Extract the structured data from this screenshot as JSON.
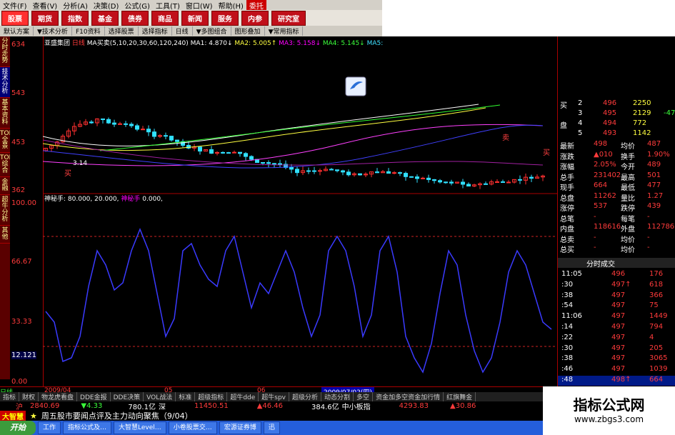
{
  "menu": [
    "文件(F)",
    "查看(V)",
    "分析(A)",
    "决策(D)",
    "公式(G)",
    "工具(T)",
    "窗口(W)",
    "帮助(H)",
    "委托"
  ],
  "tabs": [
    "股票",
    "期货",
    "指数",
    "基金",
    "债券",
    "商品",
    "新闻",
    "服务",
    "内参",
    "研究室"
  ],
  "toolbar": [
    "默认方案",
    "▼技术分析",
    "F10资料",
    "选择股票",
    "选择指标",
    "日线",
    "▼多图组合",
    "图形叠加",
    "▼常用指标"
  ],
  "left_tabs": [
    "分时走势",
    "技术分析",
    "基本资料",
    "TOP全景",
    "TOP综合",
    "金融",
    "超牛分析",
    "其他"
  ],
  "price_axis": [
    "634",
    "543",
    "453",
    "362"
  ],
  "ind_axis": [
    "100.00",
    "66.67",
    "33.33",
    "12.121",
    "0.00"
  ],
  "price_info": {
    "name": "亚盛集团",
    "period": "日线",
    "ma_label": "MA买卖(5,10,20,30,60,120,240)",
    "ma1": "MA1: 4.870↓",
    "ma2": "MA2: 5.005↑",
    "ma3": "MA3: 5.158↓",
    "ma4": "MA4: 5.145↓",
    "ma5": "MA5:"
  },
  "ind_info": {
    "name": "神秘手:",
    "v1": "80.000,",
    "v2": "20.000,",
    "name2": "神秘手",
    "v3": "0.000,"
  },
  "chart_labels": {
    "low": "3.14",
    "buy1": "买",
    "buy2": "买",
    "sell": "卖"
  },
  "bidask": [
    {
      "label": "买",
      "n": "2",
      "price": "496",
      "vol": "2250"
    },
    {
      "label": "",
      "n": "3",
      "price": "495",
      "vol": "2129",
      "extra": "-47"
    },
    {
      "label": "盘",
      "n": "4",
      "price": "494",
      "vol": "772"
    },
    {
      "label": "",
      "n": "5",
      "price": "493",
      "vol": "1142"
    }
  ],
  "quote": [
    {
      "k1": "最新",
      "v1": "498",
      "k2": "均价",
      "v2": "487"
    },
    {
      "k1": "涨跌",
      "v1": "▲010",
      "k2": "换手",
      "v2": "1.90%"
    },
    {
      "k1": "涨幅",
      "v1": "2.05%",
      "k2": "今开",
      "v2": "489"
    },
    {
      "k1": "总手",
      "v1": "231402",
      "k2": "最高",
      "v2": "501"
    },
    {
      "k1": "现手",
      "v1": "664",
      "k2": "最低",
      "v2": "477"
    },
    {
      "k1": "总盘",
      "v1": "11262",
      "k2": "量比",
      "v2": "1.27"
    },
    {
      "k1": "涨停",
      "v1": "537",
      "k2": "跌停",
      "v2": "439"
    },
    {
      "k1": "总笔",
      "v1": "-",
      "k2": "每笔",
      "v2": "-"
    },
    {
      "k1": "内盘",
      "v1": "118616",
      "k2": "外盘",
      "v2": "112786"
    },
    {
      "k1": "总卖",
      "v1": "-",
      "k2": "均价",
      "v2": "-"
    },
    {
      "k1": "总买",
      "v1": "-",
      "k2": "均价",
      "v2": "-"
    }
  ],
  "ticks_title": "分时成交",
  "ticks": [
    {
      "t": "11:05",
      "p": "496",
      "v": "176"
    },
    {
      "t": ":30",
      "p": "497↑",
      "v": "618"
    },
    {
      "t": ":38",
      "p": "497",
      "v": "366"
    },
    {
      "t": ":54",
      "p": "497",
      "v": "75"
    },
    {
      "t": "11:06",
      "p": "497",
      "v": "1449"
    },
    {
      "t": ":14",
      "p": "497",
      "v": "794"
    },
    {
      "t": ":22",
      "p": "497",
      "v": "4"
    },
    {
      "t": ":30",
      "p": "497",
      "v": "205"
    },
    {
      "t": ":38",
      "p": "497",
      "v": "3065"
    },
    {
      "t": ":46",
      "p": "497",
      "v": "1039"
    },
    {
      "t": ":48",
      "p": "498↑",
      "v": "664"
    }
  ],
  "date_bar": {
    "left": "2009/04",
    "mid1": "05",
    "mid2": "06",
    "date": "2009/07/02(四)",
    "period": "日线"
  },
  "bottom_tabs": [
    "指标",
    "财权",
    "物龙虎看盘",
    "DDE金报",
    "DDE决策",
    "VOL战法",
    "标准",
    "超级指标",
    "超牛dde",
    "超牛spv",
    "超级分析",
    "动态分割",
    "多空",
    "资金加多空资金加行情",
    "红旗舞金"
  ],
  "index_bar": {
    "sh": "沪",
    "sh_val": "2840.69",
    "sh_chg": "▼4.33",
    "sh_amt": "780.1亿",
    "sz": "深",
    "sz_val": "11450.51",
    "sz_chg": "▲46.46",
    "sz_amt": "384.6亿",
    "sm": "中小板指",
    "sm_val": "4293.83",
    "sm_chg": "▲30.86"
  },
  "news": {
    "brand": "大智慧",
    "text": "周五股市要闻点评及主力动向聚焦（9/04）"
  },
  "taskbar": [
    "开始",
    "工作",
    "指标公式及…",
    "大智慧Level…",
    "小卷股票交…",
    "宏源证券博",
    "迅"
  ],
  "watermark": {
    "title": "指标公式网",
    "url": "www.zbgs3.com"
  }
}
